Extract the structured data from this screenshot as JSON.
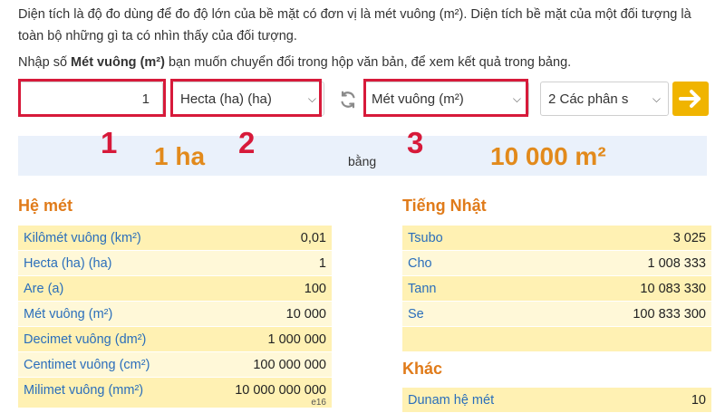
{
  "intro": "Diện tích là độ đo dùng để đo độ lớn của bề mặt có đơn vị là mét vuông (m²). Diện tích bề mặt của một đối tượng là toàn bộ những gì ta có nhìn thấy của đối tượng.",
  "hint": {
    "prefix": "Nhập số ",
    "bold": "Mét vuông (m²)",
    "suffix": " bạn muốn chuyển đổi trong hộp văn bản, để xem kết quả trong bảng."
  },
  "converter": {
    "input_value": "1",
    "from_unit": "Hecta (ha) (ha)",
    "to_unit": "Mét vuông (m²)",
    "precision": "2 Các phân s",
    "swap_icon": "swap-arrows-icon",
    "go_icon": "arrow-right-icon",
    "accent_color": "#f0b400"
  },
  "annotations": {
    "n1": "1",
    "n2": "2",
    "n3": "3",
    "color": "#d71a3a"
  },
  "result": {
    "from": "1 ha",
    "equals": "bằng",
    "to": "10 000 m²"
  },
  "sections": {
    "metric": {
      "title": "Hệ mét",
      "rows": [
        {
          "unit": "Kilômét vuông (km²)",
          "value": "0,01"
        },
        {
          "unit": "Hecta (ha) (ha)",
          "value": "1"
        },
        {
          "unit": "Are (a)",
          "value": "100"
        },
        {
          "unit": "Mét vuông (m²)",
          "value": "10 000"
        },
        {
          "unit": "Decimet vuông (dm²)",
          "value": "1 000 000"
        },
        {
          "unit": "Centimet vuông (cm²)",
          "value": "100 000 000"
        },
        {
          "unit": "Milimet vuông (mm²)",
          "value": "10 000 000 000"
        }
      ],
      "cut_value": "e16"
    },
    "japanese": {
      "title": "Tiếng Nhật",
      "rows": [
        {
          "unit": "Tsubo",
          "value": "3 025"
        },
        {
          "unit": "Cho",
          "value": "1 008 333"
        },
        {
          "unit": "Tann",
          "value": "10 083 330"
        },
        {
          "unit": "Se",
          "value": "100 833 300"
        },
        {
          "unit": "",
          "value": ""
        }
      ]
    },
    "other": {
      "title": "Khác",
      "rows": [
        {
          "unit": "Dunam hệ mét",
          "value": "10"
        }
      ]
    }
  }
}
